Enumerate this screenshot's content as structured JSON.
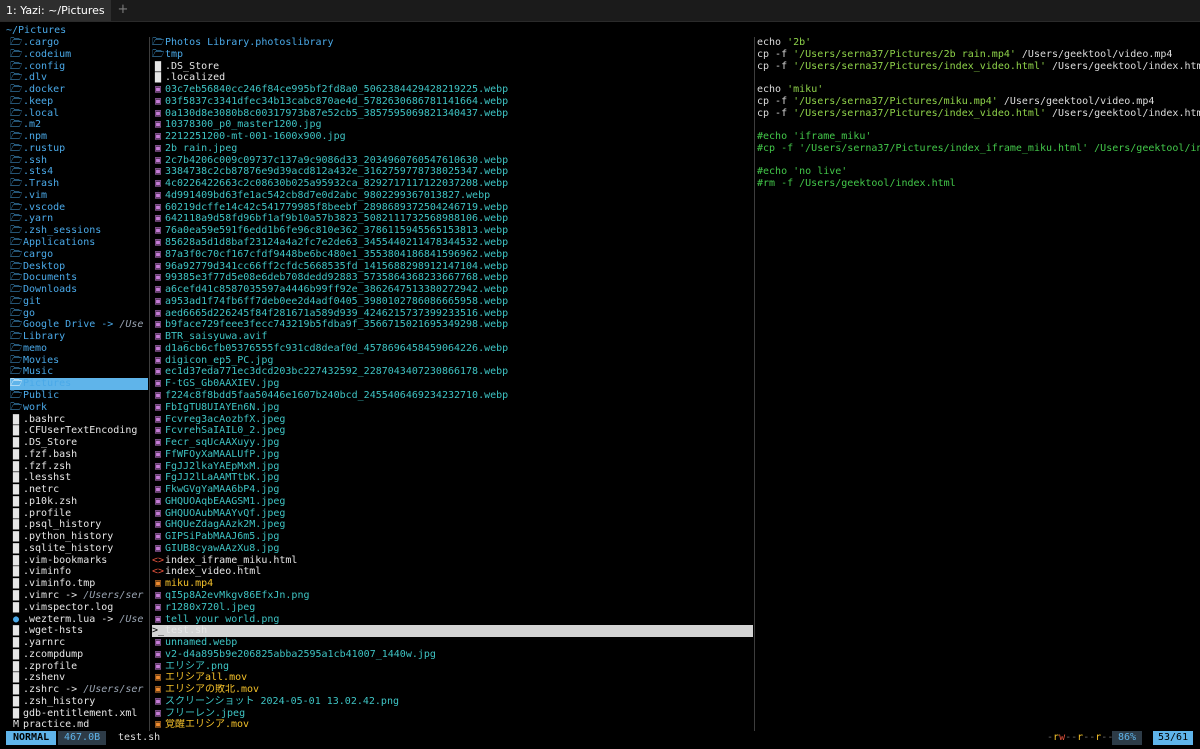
{
  "window": {
    "tab_title": "1: Yazi: ~/Pictures",
    "new_tab": "+"
  },
  "header": {
    "cwd": "~/Pictures"
  },
  "colors": {
    "accent": "#5fb4ea",
    "dir": "#4aa9e8",
    "image": "#3ec4c4",
    "video": "#f3c02a",
    "string": "#8fd34a",
    "comment": "#43c84a"
  },
  "parent": [
    {
      "name": ".cargo",
      "type": "dir"
    },
    {
      "name": ".codeium",
      "type": "dir"
    },
    {
      "name": ".config",
      "type": "dir"
    },
    {
      "name": ".dlv",
      "type": "dir"
    },
    {
      "name": ".docker",
      "type": "dir"
    },
    {
      "name": ".keep",
      "type": "dir"
    },
    {
      "name": ".local",
      "type": "dir"
    },
    {
      "name": ".m2",
      "type": "dir"
    },
    {
      "name": ".npm",
      "type": "dir"
    },
    {
      "name": ".rustup",
      "type": "dir"
    },
    {
      "name": ".ssh",
      "type": "dir"
    },
    {
      "name": ".sts4",
      "type": "dir"
    },
    {
      "name": ".Trash",
      "type": "dir"
    },
    {
      "name": ".vim",
      "type": "dir"
    },
    {
      "name": ".vscode",
      "type": "dir"
    },
    {
      "name": ".yarn",
      "type": "dir"
    },
    {
      "name": ".zsh_sessions",
      "type": "dir"
    },
    {
      "name": "Applications",
      "type": "dir"
    },
    {
      "name": "cargo",
      "type": "dir"
    },
    {
      "name": "Desktop",
      "type": "dir"
    },
    {
      "name": "Documents",
      "type": "dir"
    },
    {
      "name": "Downloads",
      "type": "dir"
    },
    {
      "name": "git",
      "type": "dir"
    },
    {
      "name": "go",
      "type": "dir"
    },
    {
      "name": "Google Drive ->",
      "type": "dir",
      "link": "/Use"
    },
    {
      "name": "Library",
      "type": "dir"
    },
    {
      "name": "memo",
      "type": "dir"
    },
    {
      "name": "Movies",
      "type": "dir"
    },
    {
      "name": "Music",
      "type": "dir"
    },
    {
      "name": "Pictures",
      "type": "dir",
      "selected": true
    },
    {
      "name": "Public",
      "type": "dir"
    },
    {
      "name": "work",
      "type": "dir"
    },
    {
      "name": ".bashrc",
      "type": "file"
    },
    {
      "name": ".CFUserTextEncoding",
      "type": "file"
    },
    {
      "name": ".DS_Store",
      "type": "file"
    },
    {
      "name": ".fzf.bash",
      "type": "file"
    },
    {
      "name": ".fzf.zsh",
      "type": "file"
    },
    {
      "name": ".lesshst",
      "type": "file"
    },
    {
      "name": ".netrc",
      "type": "file"
    },
    {
      "name": ".p10k.zsh",
      "type": "file"
    },
    {
      "name": ".profile",
      "type": "file"
    },
    {
      "name": ".psql_history",
      "type": "file"
    },
    {
      "name": ".python_history",
      "type": "file"
    },
    {
      "name": ".sqlite_history",
      "type": "file"
    },
    {
      "name": ".vim-bookmarks",
      "type": "file"
    },
    {
      "name": ".viminfo",
      "type": "file"
    },
    {
      "name": ".viminfo.tmp",
      "type": "file"
    },
    {
      "name": ".vimrc ->",
      "type": "file",
      "link": "/Users/ser"
    },
    {
      "name": ".vimspector.log",
      "type": "file"
    },
    {
      "name": ".wezterm.lua ->",
      "type": "lua",
      "link": "/Use"
    },
    {
      "name": ".wget-hsts",
      "type": "file"
    },
    {
      "name": ".yarnrc",
      "type": "file"
    },
    {
      "name": ".zcompdump",
      "type": "file"
    },
    {
      "name": ".zprofile",
      "type": "file"
    },
    {
      "name": ".zshenv",
      "type": "file"
    },
    {
      "name": ".zshrc ->",
      "type": "file",
      "link": "/Users/ser"
    },
    {
      "name": ".zsh_history",
      "type": "file"
    },
    {
      "name": "gdb-entitlement.xml",
      "type": "file"
    },
    {
      "name": "practice.md",
      "type": "md"
    }
  ],
  "current": [
    {
      "name": "Photos Library.photoslibrary",
      "type": "dir"
    },
    {
      "name": "tmp",
      "type": "dir"
    },
    {
      "name": ".DS_Store",
      "type": "file"
    },
    {
      "name": ".localized",
      "type": "file"
    },
    {
      "name": "03c7eb56840cc246f84ce995bf2fd8a0_5062384429428219225.webp",
      "type": "img"
    },
    {
      "name": "03f5837c3341dfec34b13cabc870ae4d_5782630686781141664.webp",
      "type": "img"
    },
    {
      "name": "0a130d8e3080b8c00317973b87e52cb5_3857595069821340437.webp",
      "type": "img"
    },
    {
      "name": "10378300_p0_master1200.jpg",
      "type": "img"
    },
    {
      "name": "2212251200-mt-001-1600x900.jpg",
      "type": "img"
    },
    {
      "name": "2b rain.jpeg",
      "type": "img"
    },
    {
      "name": "2c7b4206c009c09737c137a9c9086d33_2034960760547610630.webp",
      "type": "img"
    },
    {
      "name": "3384738c2cb87876e9d39acd812a432e_3162759778738025347.webp",
      "type": "img"
    },
    {
      "name": "4c0226422663c2c08630b025a95932ca_8292717117122037208.webp",
      "type": "img"
    },
    {
      "name": "4d991409bd63fe1ac542cb8d7e0d2abc_9802299367013827.webp",
      "type": "img"
    },
    {
      "name": "60219dcffe14c42c541779985f8beebf_2898689372504246719.webp",
      "type": "img"
    },
    {
      "name": "642118a9d58fd96bf1af9b10a57b3823_5082111732568988106.webp",
      "type": "img"
    },
    {
      "name": "76a0ea59e591f6edd1b6fe96c810e362_3786115945565153813.webp",
      "type": "img"
    },
    {
      "name": "85628a5d1d8baf23124a4a2fc7e2de63_3455440211478344532.webp",
      "type": "img"
    },
    {
      "name": "87a3f0c70cf167cfdf9448be6bc480e1_3553804186841596962.webp",
      "type": "img"
    },
    {
      "name": "96a92779d341cc66ff2cfdc5668535fd_1415688298912147104.webp",
      "type": "img"
    },
    {
      "name": "99385e3f77d5e08e6deb708dedd92883_5735864368233667768.webp",
      "type": "img"
    },
    {
      "name": "a6cefd41c8587035597a4446b99ff92e_3862647513380272942.webp",
      "type": "img"
    },
    {
      "name": "a953ad1f74fb6ff7deb0ee2d4adf0405_3980102786086665958.webp",
      "type": "img"
    },
    {
      "name": "aed6665d226245f84f281671a589d939_4246215737399233516.webp",
      "type": "img"
    },
    {
      "name": "b9face729feee3fecc743219b5fdba9f_3566715021695349298.webp",
      "type": "img"
    },
    {
      "name": "BTR_saisyuwa.avif",
      "type": "img"
    },
    {
      "name": "d1a6cb6cfb05376555fc931cd8deaf0d_4578696458459064226.webp",
      "type": "img"
    },
    {
      "name": "digicon_ep5_PC.jpg",
      "type": "img"
    },
    {
      "name": "ec1d37eda771ec3dcd203bc227432592_2287043407230866178.webp",
      "type": "img"
    },
    {
      "name": "F-tGS_Gb0AAXIEV.jpg",
      "type": "img"
    },
    {
      "name": "f224c8f8bdd5faa50446e1607b240bcd_2455406469234232710.webp",
      "type": "img"
    },
    {
      "name": "FbIgTU8UIAYEn6N.jpg",
      "type": "img"
    },
    {
      "name": "Fcvreg3acAozbfX.jpeg",
      "type": "img"
    },
    {
      "name": "FcvrehSaIAIL0_2.jpeg",
      "type": "img"
    },
    {
      "name": "Fecr_sqUcAAXuyy.jpg",
      "type": "img"
    },
    {
      "name": "FfWFOyXaMAALUfP.jpg",
      "type": "img"
    },
    {
      "name": "FgJJ2lkaYAEpMxM.jpg",
      "type": "img"
    },
    {
      "name": "FgJJ2lLaAAMTtbK.jpg",
      "type": "img"
    },
    {
      "name": "FkwGVgYaMAA6bP4.jpg",
      "type": "img"
    },
    {
      "name": "GHQUOAqbEAAGSM1.jpeg",
      "type": "img"
    },
    {
      "name": "GHQUOAubMAAYvQf.jpeg",
      "type": "img"
    },
    {
      "name": "GHQUeZdagAAzk2M.jpeg",
      "type": "img"
    },
    {
      "name": "GIPSiPabMAAJ6m5.jpg",
      "type": "img"
    },
    {
      "name": "GIUB8cyawAAzXu8.jpg",
      "type": "img"
    },
    {
      "name": "index_iframe_miku.html",
      "type": "html"
    },
    {
      "name": "index_video.html",
      "type": "html"
    },
    {
      "name": "miku.mp4",
      "type": "vid"
    },
    {
      "name": "qI5p8A2evMkgv86EfxJn.png",
      "type": "img"
    },
    {
      "name": "r1280x720l.jpeg",
      "type": "img"
    },
    {
      "name": "tell your world.png",
      "type": "img"
    },
    {
      "name": "test.sh",
      "type": "sh",
      "hovered": true
    },
    {
      "name": "unnamed.webp",
      "type": "img"
    },
    {
      "name": "v2-d4a895b9e206825abba2595a1cb41007_1440w.jpg",
      "type": "img"
    },
    {
      "name": "エリシア.png",
      "type": "img"
    },
    {
      "name": "エリシアall.mov",
      "type": "vid"
    },
    {
      "name": "エリシアの敗北.mov",
      "type": "vid"
    },
    {
      "name": "スクリーンショット 2024-05-01 13.02.42.png",
      "type": "img"
    },
    {
      "name": "フリーレン.jpeg",
      "type": "img"
    },
    {
      "name": "覚醒エリシア.mov",
      "type": "vid"
    }
  ],
  "preview": [
    [
      {
        "t": "echo ",
        "k": "default"
      },
      {
        "t": "'2b'",
        "k": "string"
      }
    ],
    [
      {
        "t": "cp -f ",
        "k": "default"
      },
      {
        "t": "'/Users/serna37/Pictures/2b rain.mp4'",
        "k": "string"
      },
      {
        "t": " /Users/geektool/video.mp4",
        "k": "default"
      }
    ],
    [
      {
        "t": "cp -f ",
        "k": "default"
      },
      {
        "t": "'/Users/serna37/Pictures/index_video.html'",
        "k": "string"
      },
      {
        "t": " /Users/geektool/index.htm",
        "k": "default"
      }
    ],
    [],
    [
      {
        "t": "echo ",
        "k": "default"
      },
      {
        "t": "'miku'",
        "k": "string"
      }
    ],
    [
      {
        "t": "cp -f ",
        "k": "default"
      },
      {
        "t": "'/Users/serna37/Pictures/miku.mp4'",
        "k": "string"
      },
      {
        "t": " /Users/geektool/video.mp4",
        "k": "default"
      }
    ],
    [
      {
        "t": "cp -f ",
        "k": "default"
      },
      {
        "t": "'/Users/serna37/Pictures/index_video.html'",
        "k": "string"
      },
      {
        "t": " /Users/geektool/index.htm",
        "k": "default"
      }
    ],
    [],
    [
      {
        "t": "#echo 'iframe_miku'",
        "k": "comment"
      }
    ],
    [
      {
        "t": "#cp -f '/Users/serna37/Pictures/index_iframe_miku.html' /Users/geektool/in",
        "k": "comment"
      }
    ],
    [],
    [
      {
        "t": "#echo 'no live'",
        "k": "comment"
      }
    ],
    [
      {
        "t": "#rm -f /Users/geektool/index.html",
        "k": "comment"
      }
    ]
  ],
  "icons": {
    "dir": "🗁",
    "file": "▇",
    "img": "▣",
    "vid": "▣",
    "html": "<>",
    "sh": ">_",
    "lua": "●",
    "md": "M"
  },
  "status": {
    "mode": "NORMAL",
    "size": "467.0B",
    "filename": "test.sh",
    "permissions": [
      {
        "c": "-",
        "k": "d"
      },
      {
        "c": "r",
        "k": "r"
      },
      {
        "c": "w",
        "k": "w"
      },
      {
        "c": "-",
        "k": "d"
      },
      {
        "c": "-",
        "k": "d"
      },
      {
        "c": "r",
        "k": "r"
      },
      {
        "c": "-",
        "k": "d"
      },
      {
        "c": "-",
        "k": "d"
      },
      {
        "c": "r",
        "k": "r"
      },
      {
        "c": "-",
        "k": "d"
      },
      {
        "c": "-",
        "k": "d"
      }
    ],
    "percent": "86%",
    "position": "53/61"
  }
}
